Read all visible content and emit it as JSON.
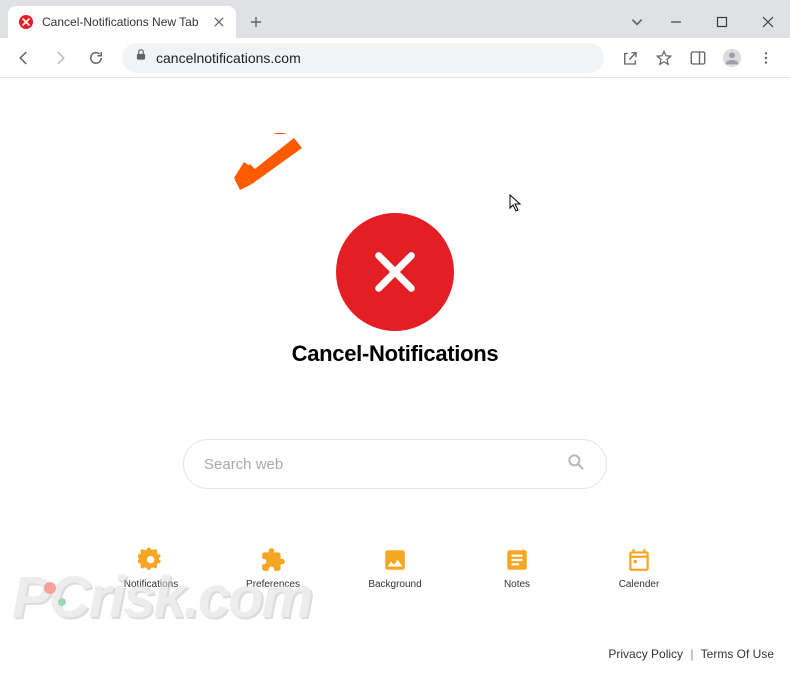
{
  "browser": {
    "tab": {
      "title": "Cancel-Notifications New Tab"
    },
    "url": "cancelnotifications.com"
  },
  "page": {
    "brand": "Cancel-Notifications",
    "search_placeholder": "Search web",
    "icons": [
      {
        "label": "Notifications"
      },
      {
        "label": "Preferences"
      },
      {
        "label": "Background"
      },
      {
        "label": "Notes"
      },
      {
        "label": "Calender"
      }
    ],
    "footer": {
      "privacy": "Privacy Policy",
      "terms": "Terms Of Use"
    }
  },
  "watermark": "PCrisk.com",
  "colors": {
    "accent_orange": "#f5a623",
    "logo_red": "#e31e24"
  }
}
